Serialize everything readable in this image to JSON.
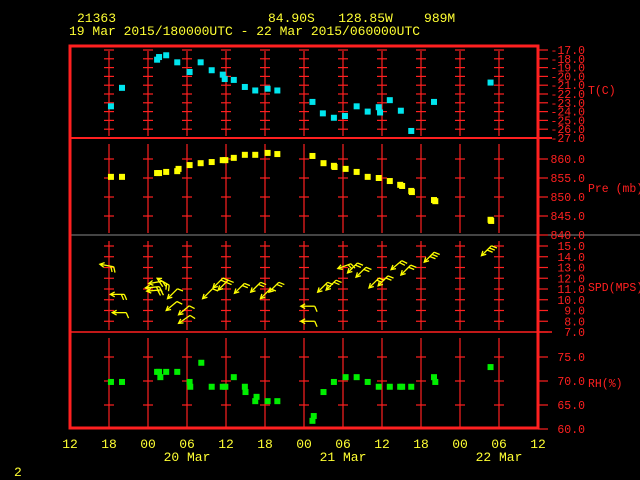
{
  "header": {
    "station": "21363",
    "location": "84.90S   128.85W    989M",
    "period": "19 Mar 2015/180000UTC - 22 Mar 2015/060000UTC"
  },
  "footer": {
    "page": "2"
  },
  "colors": {
    "frame": "#ff2020",
    "text": "#ffff33",
    "temp": "#00e5ee",
    "pressure": "#ffff00",
    "wind": "#ffff00",
    "rh": "#00ee00"
  },
  "chart_data": {
    "type": "scatter",
    "x_unit": "hours since 19 Mar 12 UTC",
    "x_ticks": [
      "12",
      "18",
      "00",
      "06",
      "12",
      "18",
      "00",
      "06",
      "12",
      "18",
      "00",
      "06",
      "12"
    ],
    "x_dates": [
      "20 Mar",
      "21 Mar",
      "22 Mar"
    ],
    "xlim": [
      0,
      72
    ],
    "panels": [
      {
        "name": "temperature",
        "label": "T(C)",
        "ylim": [
          -27,
          -17
        ],
        "ticks": [
          "-17.0",
          "-18.0",
          "-19.0",
          "-20.0",
          "-21.0",
          "-22.0",
          "-23.0",
          "-24.0",
          "-25.0",
          "-26.0",
          "-27.0"
        ],
        "points": [
          [
            6.3,
            -23.4
          ],
          [
            8.0,
            -21.3
          ],
          [
            13.4,
            -18.1
          ],
          [
            13.7,
            -17.8
          ],
          [
            14.8,
            -17.6
          ],
          [
            16.5,
            -18.4
          ],
          [
            18.4,
            -19.5
          ],
          [
            20.1,
            -18.4
          ],
          [
            21.8,
            -19.3
          ],
          [
            23.5,
            -19.8
          ],
          [
            23.8,
            -20.3
          ],
          [
            25.2,
            -20.4
          ],
          [
            26.9,
            -21.2
          ],
          [
            28.5,
            -21.6
          ],
          [
            30.4,
            -21.4
          ],
          [
            31.9,
            -21.6
          ],
          [
            37.3,
            -22.9
          ],
          [
            38.9,
            -24.2
          ],
          [
            40.6,
            -24.7
          ],
          [
            42.3,
            -24.5
          ],
          [
            44.1,
            -23.4
          ],
          [
            45.8,
            -24.0
          ],
          [
            47.5,
            -23.5
          ],
          [
            47.7,
            -24.1
          ],
          [
            49.2,
            -22.7
          ],
          [
            50.9,
            -23.9
          ],
          [
            52.5,
            -26.2
          ],
          [
            56.0,
            -22.9
          ],
          [
            64.7,
            -20.7
          ]
        ]
      },
      {
        "name": "pressure",
        "label": "Pre (mb)",
        "ylim": [
          840,
          865
        ],
        "ticks": [
          "860.0",
          "855.0",
          "850.0",
          "845.0",
          "840.0"
        ],
        "points": [
          [
            6.3,
            855.3
          ],
          [
            8.0,
            855.3
          ],
          [
            13.4,
            856.3
          ],
          [
            13.7,
            856.3
          ],
          [
            14.8,
            856.6
          ],
          [
            16.5,
            856.8
          ],
          [
            16.7,
            857.4
          ],
          [
            18.4,
            858.4
          ],
          [
            20.1,
            858.9
          ],
          [
            21.8,
            859.2
          ],
          [
            23.5,
            859.7
          ],
          [
            23.9,
            859.7
          ],
          [
            25.2,
            860.3
          ],
          [
            26.9,
            861.1
          ],
          [
            28.5,
            861.1
          ],
          [
            30.4,
            861.6
          ],
          [
            31.9,
            861.3
          ],
          [
            37.3,
            860.8
          ],
          [
            39.0,
            858.9
          ],
          [
            40.6,
            858.2
          ],
          [
            40.7,
            857.9
          ],
          [
            42.4,
            857.4
          ],
          [
            44.1,
            856.6
          ],
          [
            45.8,
            855.3
          ],
          [
            47.5,
            855.0
          ],
          [
            49.2,
            854.2
          ],
          [
            50.8,
            853.2
          ],
          [
            51.1,
            852.9
          ],
          [
            52.5,
            851.6
          ],
          [
            52.6,
            851.3
          ],
          [
            56.0,
            849.2
          ],
          [
            56.2,
            848.9
          ],
          [
            64.7,
            844.0
          ],
          [
            64.8,
            843.7
          ]
        ]
      },
      {
        "name": "wind",
        "label": "SPD(MPS)",
        "ylim": [
          7,
          15
        ],
        "ticks": [
          "15.0",
          "14.0",
          "13.0",
          "12.0",
          "11.0",
          "10.0",
          "9.0",
          "8.0",
          "7.0"
        ],
        "points": [
          [
            4.6,
            13.3,
            280
          ],
          [
            6.2,
            10.5,
            270
          ],
          [
            6.5,
            8.8,
            270
          ],
          [
            11.6,
            11.1,
            265
          ],
          [
            11.8,
            10.8,
            265
          ],
          [
            12.1,
            11.5,
            260
          ],
          [
            13.4,
            12.0,
            300
          ],
          [
            15.0,
            10.1,
            225
          ],
          [
            14.8,
            9.0,
            230
          ],
          [
            16.7,
            8.6,
            230
          ],
          [
            16.7,
            7.8,
            235
          ],
          [
            20.4,
            10.1,
            225
          ],
          [
            22.0,
            11.1,
            225
          ],
          [
            22.8,
            10.9,
            225
          ],
          [
            25.3,
            10.6,
            225
          ],
          [
            27.8,
            10.7,
            225
          ],
          [
            29.3,
            10.1,
            225
          ],
          [
            30.6,
            10.7,
            225
          ],
          [
            35.5,
            9.4,
            270
          ],
          [
            35.5,
            8.0,
            270
          ],
          [
            38.1,
            10.7,
            225
          ],
          [
            39.4,
            10.9,
            225
          ],
          [
            41.2,
            12.9,
            250
          ],
          [
            42.7,
            12.5,
            225
          ],
          [
            44.0,
            12.1,
            225
          ],
          [
            46.0,
            11.1,
            225
          ],
          [
            47.4,
            11.3,
            225
          ],
          [
            49.4,
            12.8,
            230
          ],
          [
            50.9,
            12.3,
            225
          ],
          [
            54.5,
            13.5,
            225
          ],
          [
            63.3,
            14.1,
            225
          ]
        ]
      },
      {
        "name": "rh",
        "label": "RH(%)",
        "ylim": [
          60,
          80
        ],
        "ticks": [
          "75.0",
          "70.0",
          "65.0",
          "60.0"
        ],
        "points": [
          [
            6.3,
            69.8
          ],
          [
            8.0,
            69.8
          ],
          [
            13.4,
            71.9
          ],
          [
            13.7,
            71.9
          ],
          [
            13.9,
            70.8
          ],
          [
            14.8,
            71.9
          ],
          [
            16.5,
            71.9
          ],
          [
            18.4,
            69.8
          ],
          [
            18.5,
            68.8
          ],
          [
            20.2,
            73.8
          ],
          [
            21.8,
            68.8
          ],
          [
            23.5,
            68.8
          ],
          [
            23.9,
            68.8
          ],
          [
            25.2,
            70.8
          ],
          [
            26.9,
            68.8
          ],
          [
            27.0,
            67.7
          ],
          [
            28.7,
            66.7
          ],
          [
            28.5,
            65.8
          ],
          [
            30.4,
            65.8
          ],
          [
            31.9,
            65.8
          ],
          [
            37.5,
            62.7
          ],
          [
            37.3,
            61.7
          ],
          [
            39.0,
            67.7
          ],
          [
            40.6,
            69.8
          ],
          [
            42.4,
            70.8
          ],
          [
            44.1,
            70.8
          ],
          [
            45.8,
            69.8
          ],
          [
            47.5,
            68.8
          ],
          [
            49.2,
            68.8
          ],
          [
            50.8,
            68.8
          ],
          [
            51.1,
            68.8
          ],
          [
            52.5,
            68.8
          ],
          [
            56.0,
            70.8
          ],
          [
            56.2,
            69.8
          ],
          [
            64.7,
            72.9
          ]
        ]
      }
    ]
  }
}
